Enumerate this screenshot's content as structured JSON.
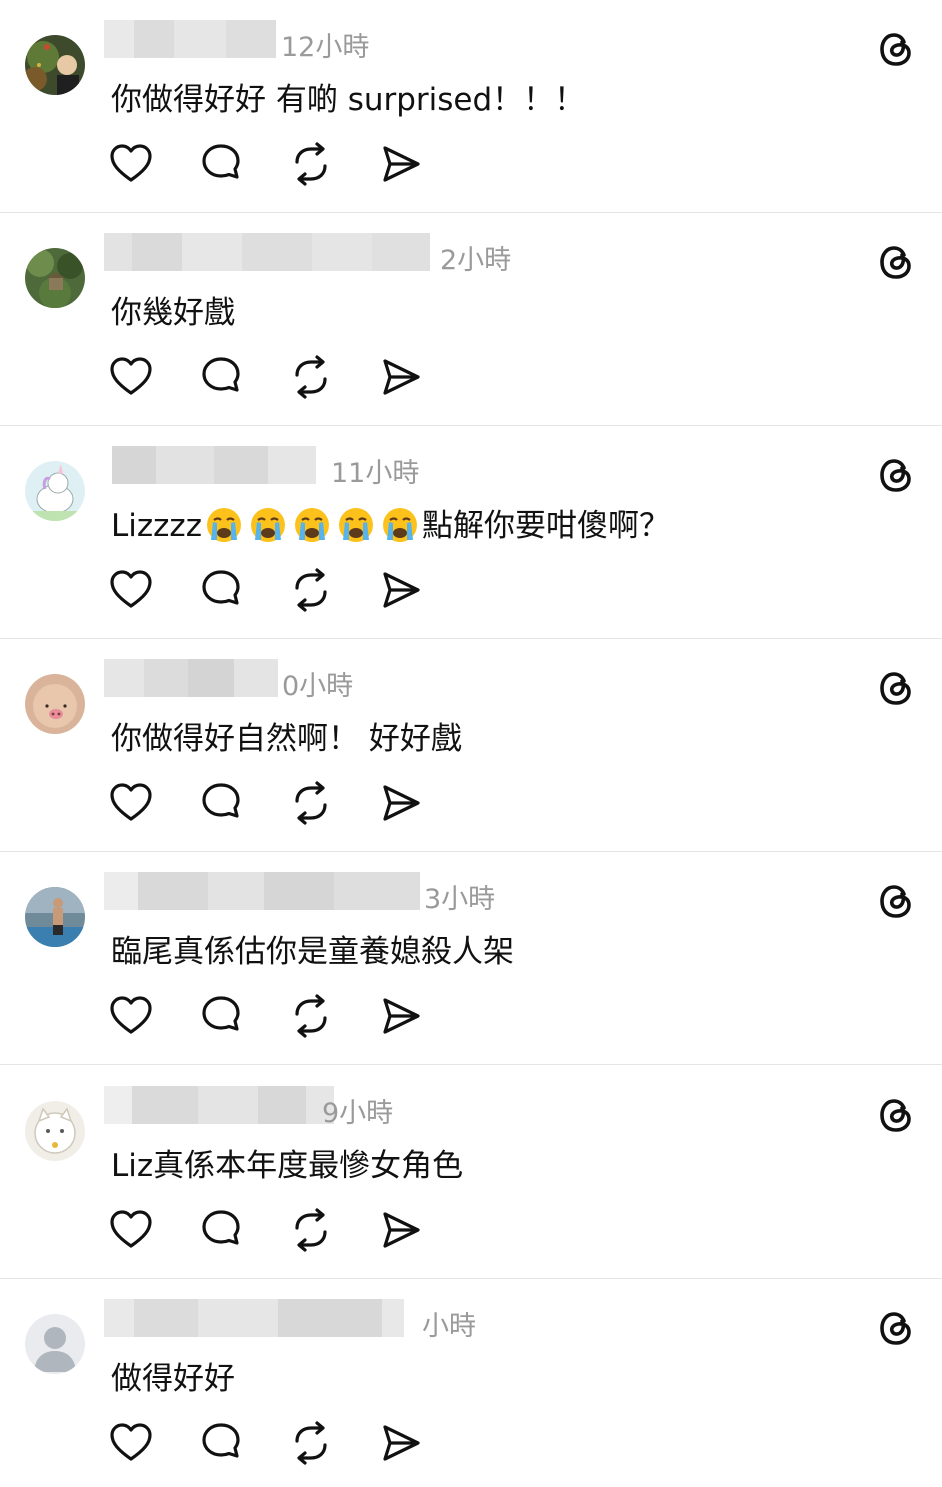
{
  "comments": [
    {
      "time": "12小時",
      "text": "你做得好好 有啲 surprised！！！"
    },
    {
      "time": "2小時",
      "text": "你幾好戲"
    },
    {
      "time": "11小時",
      "text_prefix": "Lizzzz",
      "emoji_count": 5,
      "emoji": "loudly-crying-face",
      "text_suffix": "點解你要咁傻啊？"
    },
    {
      "time": "0小時",
      "text": "你做得好自然啊！ 好好戲"
    },
    {
      "time": "3小時",
      "text": "臨尾真係估你是童養媳殺人架"
    },
    {
      "time": "9小時",
      "text": "Liz真係本年度最慘女角色"
    },
    {
      "time": "小時",
      "text": "做得好好"
    }
  ],
  "actions": [
    "heart-icon",
    "comment-icon",
    "repost-icon",
    "send-icon"
  ],
  "brand_icon": "threads-icon",
  "colors": {
    "text": "#111111",
    "meta": "#9a9a9a",
    "divider": "#e4e4e4"
  }
}
